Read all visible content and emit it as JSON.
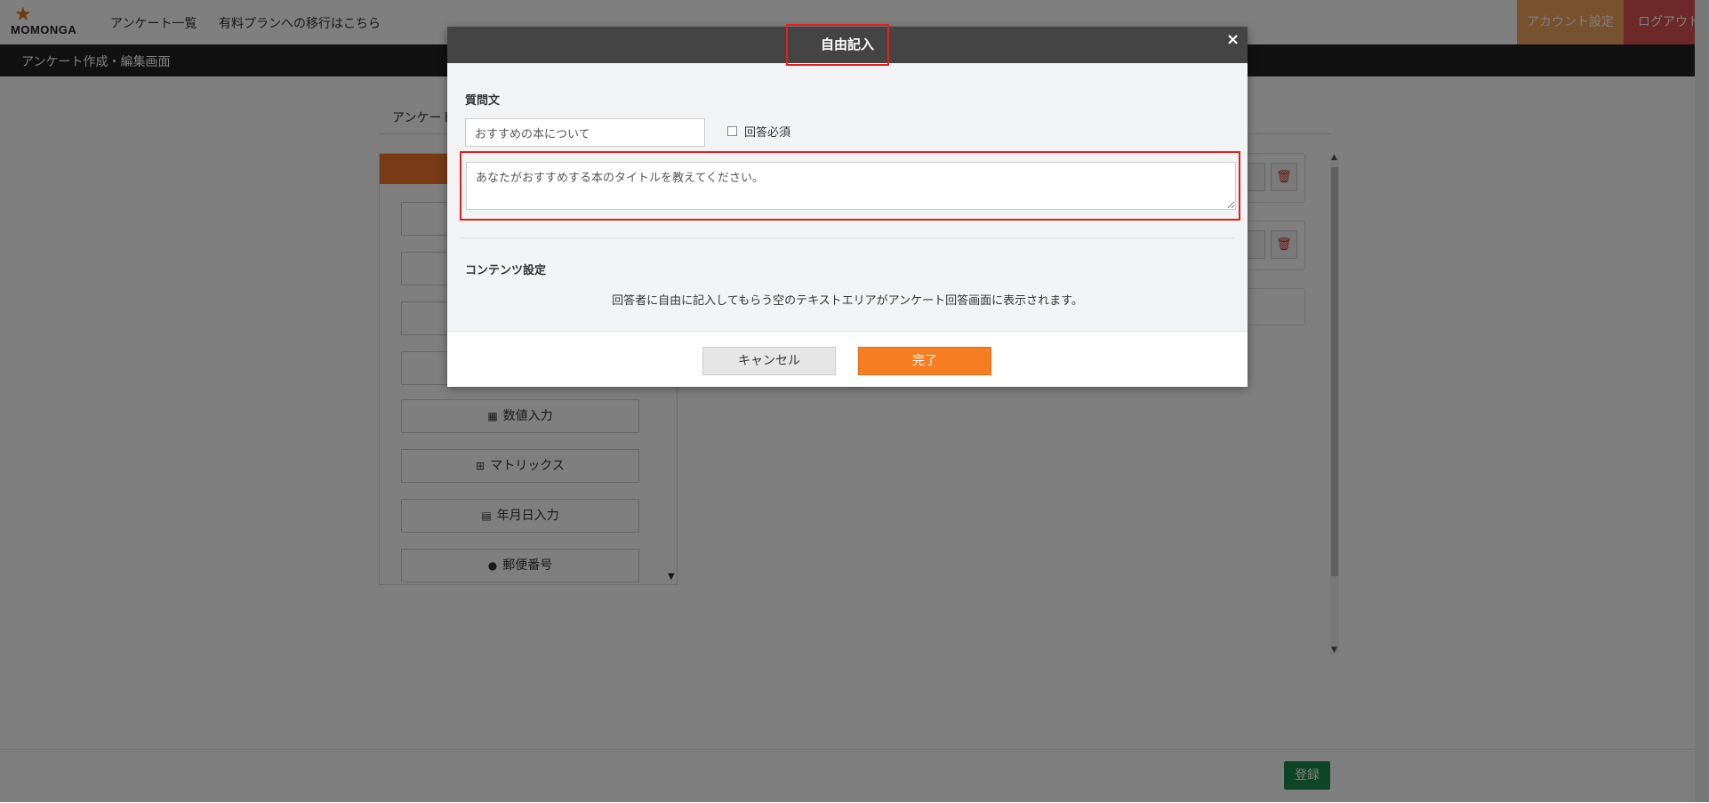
{
  "nav": {
    "logo_text": "MOMONGA",
    "links": [
      "アンケート一覧",
      "有料プランへの移行はこちら"
    ],
    "account": "アカウント設定",
    "logout": "ログアウト"
  },
  "subheader": {
    "title": "アンケート作成・編集画面"
  },
  "main": {
    "tab_label": "アンケート",
    "palette_items": [
      {
        "label": "数値入力",
        "icon": "calculator-icon"
      },
      {
        "label": "マトリックス",
        "icon": "table-icon"
      },
      {
        "label": "年月日入力",
        "icon": "calendar-icon"
      },
      {
        "label": "郵便番号",
        "icon": "map-marker-icon"
      }
    ],
    "submit": "登録"
  },
  "modal": {
    "title": "自由記入",
    "close": "×",
    "question_label": "質問文",
    "question_value": "おすすめの本について",
    "required_label": "回答必須",
    "description_value": "あなたがおすすめする本のタイトルを教えてください。",
    "content_label": "コンテンツ設定",
    "content_text": "回答者に自由に記入してもらう空のテキストエリアがアンケート回答画面に表示されます。",
    "cancel": "キャンセル",
    "done": "完了"
  },
  "colors": {
    "accent_orange": "#f57e22",
    "header_dark": "#444444",
    "highlight_red": "#e02020",
    "submit_green": "#1e8a4f",
    "logout_red": "#d9534f"
  }
}
